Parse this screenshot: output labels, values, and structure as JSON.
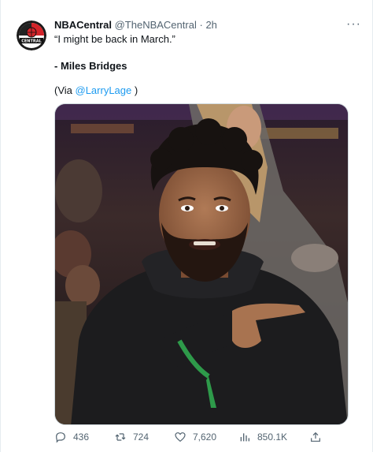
{
  "tweet": {
    "author_name": "NBACentral",
    "author_handle": "@TheNBACentral",
    "separator": "·",
    "time": "2h",
    "avatar_text": "CENTRAL",
    "quote": "“I might be back in March.”",
    "credit": "- Miles Bridges",
    "via_prefix": "(Via ",
    "via_mention": "@LarryLage",
    "via_suffix": " )",
    "more_label": "···"
  },
  "actions": {
    "replies": "436",
    "retweets": "724",
    "likes": "7,620",
    "views": "850.1K"
  },
  "icons": {
    "avatar": "nba-central-logo",
    "more": "more-icon",
    "reply": "reply-icon",
    "retweet": "retweet-icon",
    "like": "heart-icon",
    "views": "views-icon",
    "share": "share-icon"
  },
  "colors": {
    "text": "#0f1419",
    "secondary": "#536471",
    "link": "#1d9bf0",
    "border": "#cfd9de",
    "logo_red": "#d3242a"
  }
}
